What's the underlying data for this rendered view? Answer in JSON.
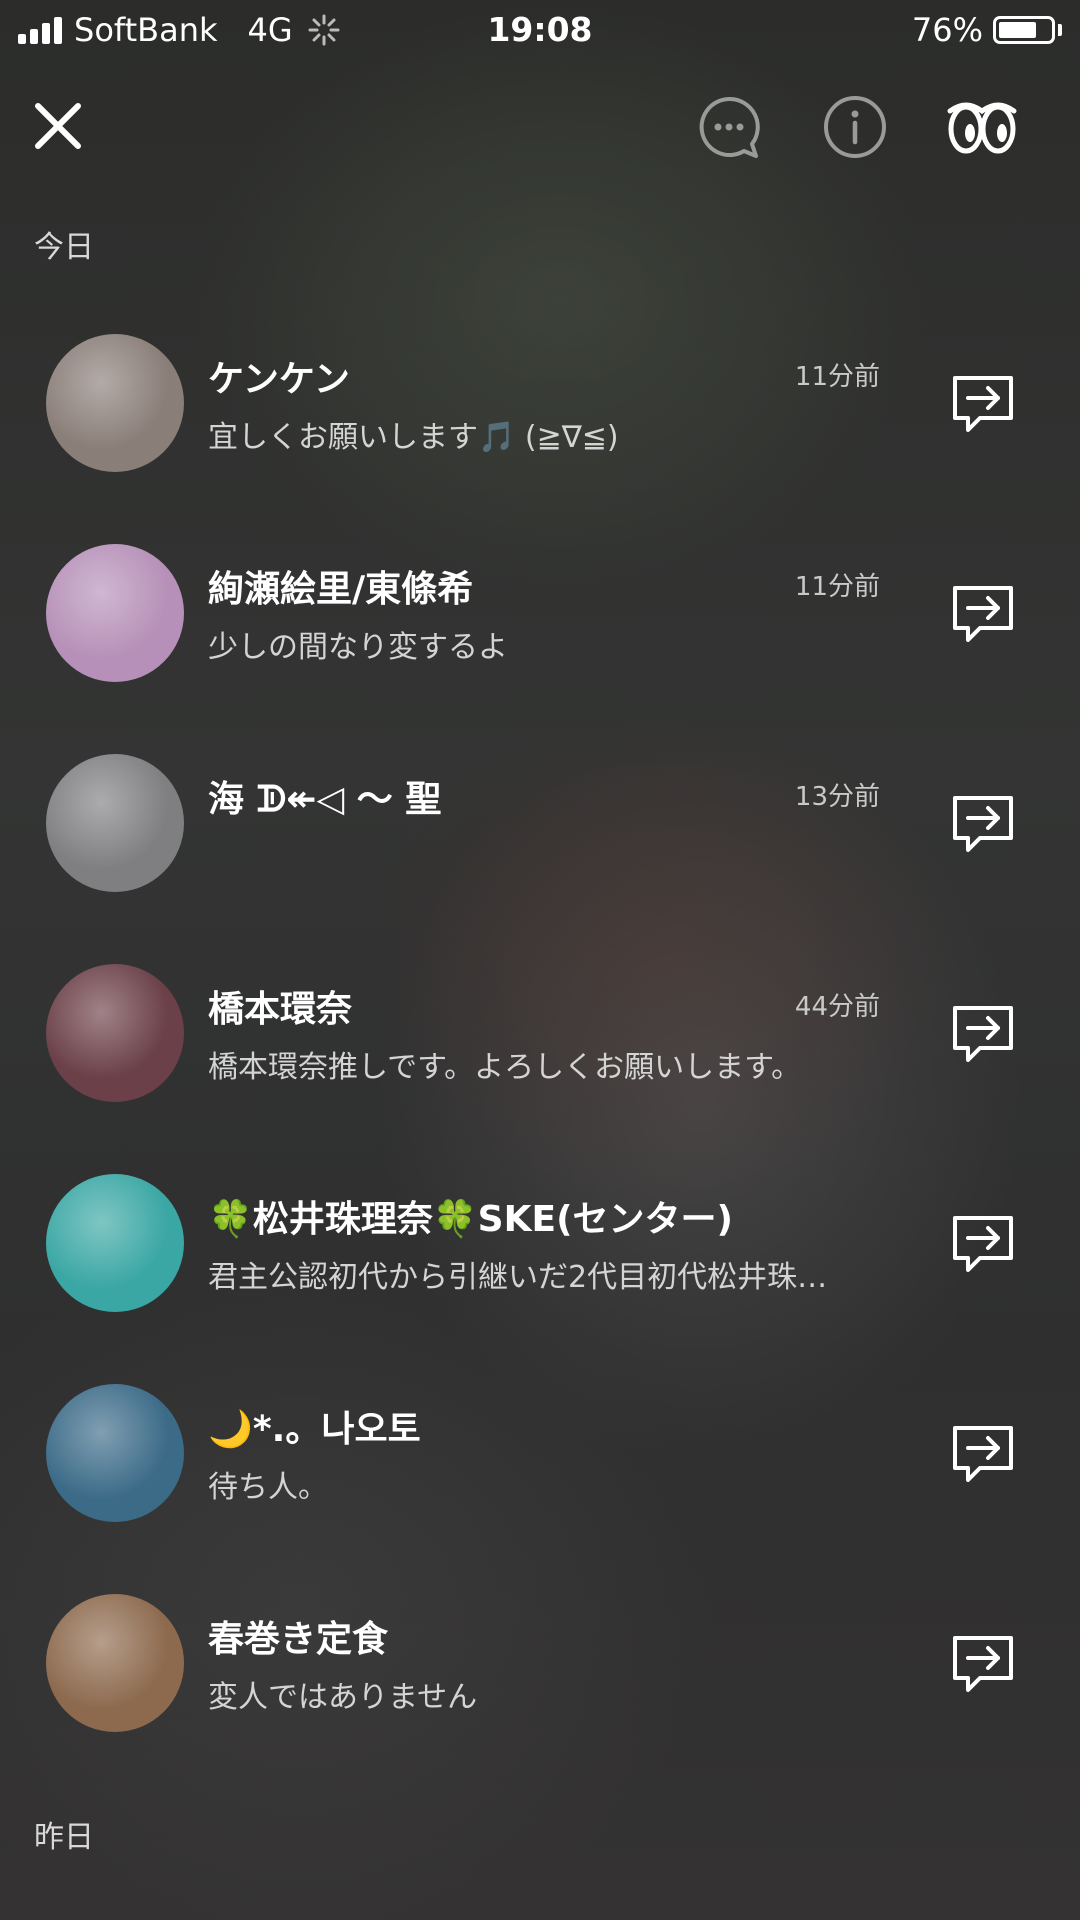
{
  "status_bar": {
    "carrier": "SoftBank",
    "network": "4G",
    "time": "19:08",
    "battery_percent_text": "76%",
    "battery_level": 0.76
  },
  "toolbar": {
    "close_icon": "close-icon",
    "chat_icon": "chat-bubble-ellipsis-icon",
    "info_icon": "info-icon",
    "follow_icon": "eyes-icon"
  },
  "sections": {
    "today": "今日",
    "yesterday": "昨日"
  },
  "colors": {
    "avatar_1": "#8a7e78",
    "avatar_2": "#b690b8",
    "avatar_3": "#7f7f82",
    "avatar_4": "#6b4048",
    "avatar_5": "#3aa7a4",
    "avatar_6": "#3c6b88",
    "avatar_7": "#8d6a4e"
  },
  "contacts": [
    {
      "name": "ケンケン",
      "time": "11分前",
      "message": "宜しくお願いします🎵 (≧∇≦)",
      "share_icon": "share-arrow-icon"
    },
    {
      "name": "絢瀬絵里/東條希",
      "time": "11分前",
      "message": "少しの間なり変するよ",
      "share_icon": "share-arrow-icon"
    },
    {
      "name": "海 ᗫ↞◁ 〜 聖",
      "time": "13分前",
      "message": "",
      "share_icon": "share-arrow-icon"
    },
    {
      "name": "橋本環奈",
      "time": "44分前",
      "message": "橋本環奈推しです。よろしくお願いします。",
      "share_icon": "share-arrow-icon"
    },
    {
      "name": "🍀松井珠理奈🍀SKE(センター)",
      "time": "",
      "message": "君主公認初代から引継いだ2代目初代松井珠…",
      "share_icon": "share-arrow-icon"
    },
    {
      "name": "🌙*.。나오토",
      "time": "",
      "message": "待ち人。",
      "share_icon": "share-arrow-icon"
    },
    {
      "name": "春巻き定食",
      "time": "",
      "message": "変人ではありません",
      "share_icon": "share-arrow-icon"
    }
  ]
}
